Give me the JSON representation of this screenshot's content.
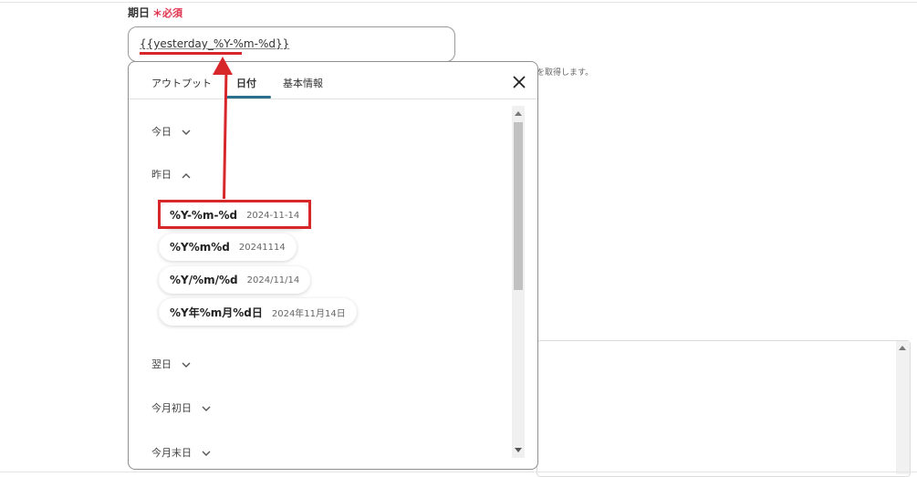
{
  "field": {
    "label": "期日",
    "required": "＊必須",
    "value": "{{yesterday_%Y-%m-%d}}"
  },
  "help_text": "を取得します。",
  "popup": {
    "tabs": [
      {
        "label": "アウトプット"
      },
      {
        "label": "日付"
      },
      {
        "label": "基本情報"
      }
    ],
    "active_tab": "日付",
    "sections": {
      "today": "今日",
      "yesterday": "昨日",
      "tomorrow": "翌日",
      "month_start": "今月初日",
      "month_end": "今月末日"
    },
    "chips": [
      {
        "format": "%Y-%m-%d",
        "sample": "2024-11-14"
      },
      {
        "format": "%Y%m%d",
        "sample": "20241114"
      },
      {
        "format": "%Y/%m/%d",
        "sample": "2024/11/14"
      },
      {
        "format": "%Y年%m月%d日",
        "sample": "2024年11月14日"
      }
    ]
  },
  "colors": {
    "required": "#e0334f",
    "annotation": "#d7272b",
    "tab_accent": "#2a6f8c"
  },
  "icons": {
    "close": "close-icon",
    "expand": "chevron-down-icon",
    "collapse": "chevron-up-icon"
  }
}
